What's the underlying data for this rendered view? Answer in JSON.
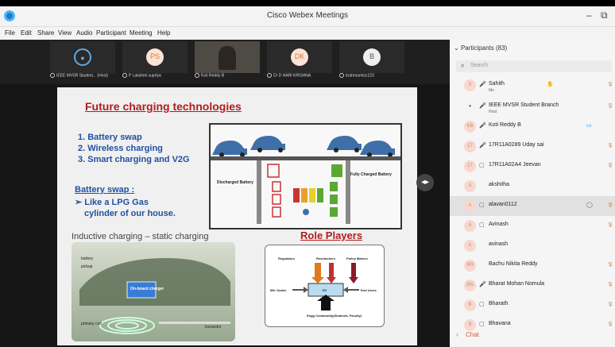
{
  "window": {
    "title": "Cisco Webex Meetings",
    "minimize": "–",
    "restore": "⧉"
  },
  "menu": [
    "File",
    "Edit",
    "Share",
    "View",
    "Audio",
    "Participant",
    "Meeting",
    "Help"
  ],
  "videostrip": [
    {
      "name": "IEEE MVSR Student... (Host)",
      "initials": ""
    },
    {
      "name": "P Lakshmi supriya",
      "initials": "PS"
    },
    {
      "name": "Koti Reddy B",
      "initials": ""
    },
    {
      "name": "Dr D HARI KRISHNA",
      "initials": "DK"
    },
    {
      "name": "brahmamtsc123",
      "initials": "B"
    }
  ],
  "slide": {
    "title": "Future charging technologies",
    "points": [
      "1.  Battery swap",
      "2.  Wireless charging",
      "3.  Smart charging and V2G"
    ],
    "swap_title": "Battery swap :",
    "swap_lines": [
      "➢ Like a LPG Gas",
      "cylinder of our house."
    ],
    "diagram_labels": {
      "discharged": "Discharged Battery",
      "charged": "Fully Charged Battery"
    },
    "inductive_title": "Inductive charging – static charging",
    "car_labels": [
      "battery",
      "pickup",
      "On-board charger",
      "primary coil",
      "transistor"
    ],
    "role_title": "Role Players",
    "role_labels": [
      "Regulators",
      "Researchers",
      "Policy Makers",
      "Mfr. Dealer",
      "EV",
      "End Users",
      "Engg Community(Students, Faculty)"
    ]
  },
  "participants": {
    "header": "Participants (83)",
    "search_placeholder": "Search",
    "chat_label": "Chat",
    "items": [
      {
        "initials": "S",
        "name": "Sahith",
        "role": "Me",
        "icon": "🎤"
      },
      {
        "initials": "",
        "name": "IEEE MVSR Student Branch",
        "role": "Host",
        "icon": "🎤"
      },
      {
        "initials": "KB",
        "name": "Koti Reddy B",
        "role": "",
        "icon": "🎤"
      },
      {
        "initials": "17",
        "name": "17R11A0289 Uday sai",
        "role": "",
        "icon": "🎤"
      },
      {
        "initials": "17",
        "name": "17R11A02A4 Jeevan",
        "role": "",
        "icon": "▢"
      },
      {
        "initials": "A",
        "name": "akshitha",
        "role": "",
        "icon": ""
      },
      {
        "initials": "A",
        "name": "alavan0112",
        "role": "",
        "icon": "▢"
      },
      {
        "initials": "A",
        "name": "Avinash",
        "role": "",
        "icon": "▢"
      },
      {
        "initials": "A",
        "name": "avinash",
        "role": "",
        "icon": ""
      },
      {
        "initials": "BR",
        "name": "Bachu Nikita Reddy",
        "role": "",
        "icon": ""
      },
      {
        "initials": "BN",
        "name": "Bharat Mohan Nomula",
        "role": "",
        "icon": "🎤"
      },
      {
        "initials": "B",
        "name": "Bharath",
        "role": "",
        "icon": "▢"
      },
      {
        "initials": "B",
        "name": "Bhavana",
        "role": "",
        "icon": "▢"
      }
    ]
  }
}
